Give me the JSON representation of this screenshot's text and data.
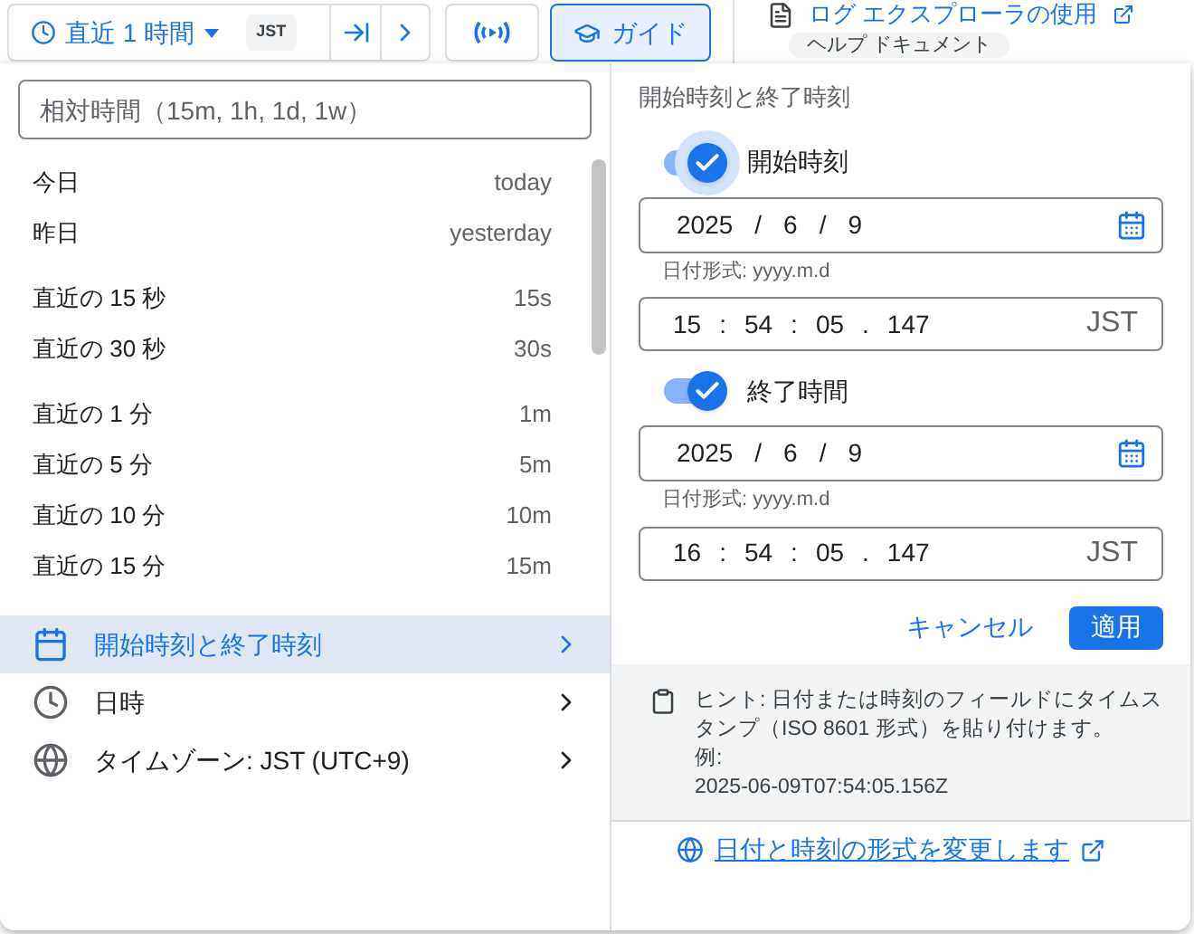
{
  "toolbar": {
    "range_label": "直近 1 時間",
    "timezone_badge": "JST",
    "guide_button": "ガイド"
  },
  "background": {
    "link": "ログ エクスプローラの使用",
    "chip": "ヘルプ ドキュメント"
  },
  "relative_input": {
    "placeholder": "相対時間（15m, 1h, 1d, 1w）"
  },
  "preset_groups": [
    {
      "items": [
        {
          "label": "今日",
          "shortcut": "today"
        },
        {
          "label": "昨日",
          "shortcut": "yesterday"
        }
      ]
    },
    {
      "items": [
        {
          "label": "直近の 15 秒",
          "shortcut": "15s"
        },
        {
          "label": "直近の 30 秒",
          "shortcut": "30s"
        }
      ]
    },
    {
      "items": [
        {
          "label": "直近の 1 分",
          "shortcut": "1m"
        },
        {
          "label": "直近の 5 分",
          "shortcut": "5m"
        },
        {
          "label": "直近の 10 分",
          "shortcut": "10m"
        },
        {
          "label": "直近の 15 分",
          "shortcut": "15m"
        }
      ]
    }
  ],
  "menu": [
    {
      "kind": "calendar",
      "label": "開始時刻と終了時刻",
      "selected": true
    },
    {
      "kind": "clock",
      "label": "日時",
      "selected": false
    },
    {
      "kind": "globe",
      "label": "タイムゾーン: JST (UTC+9)",
      "selected": false
    }
  ],
  "range": {
    "title": "開始時刻と終了時刻",
    "endpoints": [
      {
        "label": "開始時刻",
        "on": true,
        "focused": true,
        "date_parts": [
          "2025",
          "/",
          "6",
          "/",
          "9"
        ],
        "date_hint": "日付形式: yyyy.m.d",
        "time_parts": [
          "15",
          ":",
          "54",
          ":",
          "05",
          ".",
          "147"
        ],
        "timezone": "JST"
      },
      {
        "label": "終了時間",
        "on": true,
        "focused": false,
        "date_parts": [
          "2025",
          "/",
          "6",
          "/",
          "9"
        ],
        "date_hint": "日付形式: yyyy.m.d",
        "time_parts": [
          "16",
          ":",
          "54",
          ":",
          "05",
          ".",
          "147"
        ],
        "timezone": "JST"
      }
    ],
    "cancel_button": "キャンセル",
    "apply_button": "適用"
  },
  "hint": {
    "text": "ヒント: 日付または時刻のフィールドにタイムスタンプ（ISO 8601 形式）を貼り付けます。",
    "example_label": "例:",
    "example": "2025-06-09T07:54:05.156Z"
  },
  "format_link": "日付と時刻の形式を変更します"
}
